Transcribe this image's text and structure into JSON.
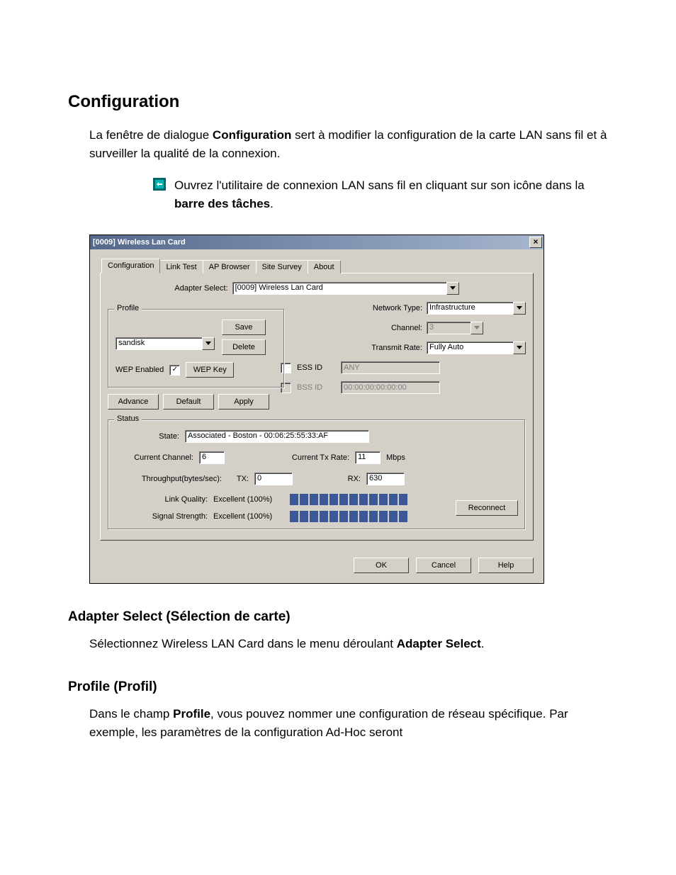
{
  "doc": {
    "heading": "Configuration",
    "para1_a": "La fenêtre de dialogue ",
    "para1_b": "Configuration",
    "para1_c": " sert à modifier la configuration de la carte LAN sans fil et à surveiller la qualité de la connexion.",
    "step1_a": "Ouvrez l'utilitaire de connexion LAN sans fil en cliquant sur son icône dans la ",
    "step1_b": "barre des tâches",
    "step1_c": ".",
    "sub1": "Adapter Select (Sélection de carte)",
    "para2_a": "Sélectionnez Wireless LAN Card dans le menu déroulant ",
    "para2_b": "Adapter Select",
    "para2_c": ".",
    "sub2": "Profile (Profil)",
    "para3_a": "Dans le champ ",
    "para3_b": "Profile",
    "para3_c": ", vous pouvez nommer une configuration de réseau spécifique. Par exemple, les paramètres de la configuration Ad-Hoc seront"
  },
  "dialog": {
    "title": "[0009] Wireless Lan Card",
    "close": "×",
    "tabs": [
      "Configuration",
      "Link Test",
      "AP Browser",
      "Site Survey",
      "About"
    ],
    "adapter_select_label": "Adapter Select:",
    "adapter_select_value": "[0009] Wireless Lan Card",
    "profile": {
      "legend": "Profile",
      "value": "sandisk",
      "save": "Save",
      "delete": "Delete",
      "wep_enabled_label": "WEP Enabled",
      "wep_enabled_checked": true,
      "wep_key": "WEP Key",
      "advance": "Advance",
      "default": "Default",
      "apply": "Apply"
    },
    "net": {
      "network_type_label": "Network Type:",
      "network_type_value": "Infrastructure",
      "channel_label": "Channel:",
      "channel_value": "3",
      "tx_rate_label": "Transmit Rate:",
      "tx_rate_value": "Fully Auto",
      "ess_id_label": "ESS ID",
      "ess_id_value": "ANY",
      "bss_id_label": "BSS ID",
      "bss_id_value": "00:00:00:00:00:00"
    },
    "status": {
      "legend": "Status",
      "state_label": "State:",
      "state_value": "Associated - Boston - 00:06:25:55:33:AF",
      "cur_channel_label": "Current Channel:",
      "cur_channel_value": "6",
      "cur_tx_label": "Current Tx Rate:",
      "cur_tx_value": "11",
      "mbps": "Mbps",
      "throughput_label": "Throughput(bytes/sec):",
      "tx_label": "TX:",
      "tx_value": "0",
      "rx_label": "RX:",
      "rx_value": "630",
      "link_quality_label": "Link Quality:",
      "link_quality_value": "Excellent (100%)",
      "signal_label": "Signal Strength:",
      "signal_value": "Excellent (100%)",
      "reconnect": "Reconnect",
      "bar_segments": 12
    },
    "footer": {
      "ok": "OK",
      "cancel": "Cancel",
      "help": "Help"
    }
  }
}
